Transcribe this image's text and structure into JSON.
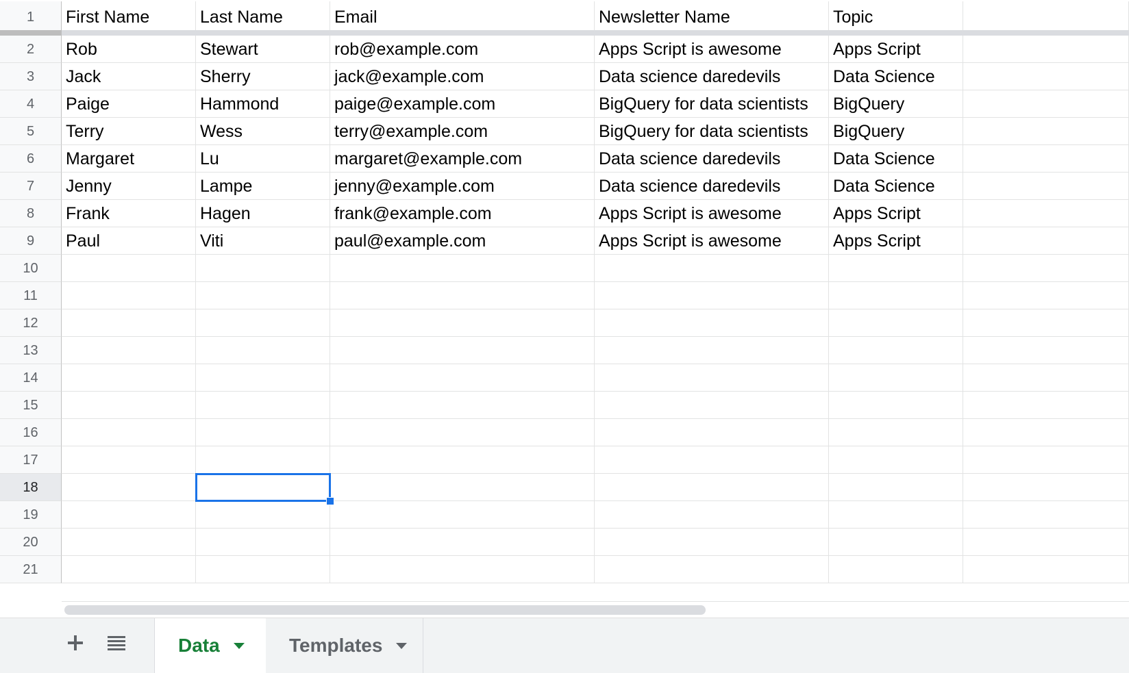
{
  "spreadsheet": {
    "row_numbers": [
      "1",
      "2",
      "3",
      "4",
      "5",
      "6",
      "7",
      "8",
      "9",
      "10",
      "11",
      "12",
      "13",
      "14",
      "15",
      "16",
      "17",
      "18",
      "19",
      "20",
      "21"
    ],
    "rows": [
      [
        "First Name",
        "Last Name",
        "Email",
        "Newsletter Name",
        "Topic",
        ""
      ],
      [
        "Rob",
        "Stewart",
        "rob@example.com",
        "Apps Script is awesome",
        "Apps Script",
        ""
      ],
      [
        "Jack",
        "Sherry",
        "jack@example.com",
        "Data science daredevils",
        "Data Science",
        ""
      ],
      [
        "Paige",
        "Hammond",
        "paige@example.com",
        "BigQuery for data scientists",
        "BigQuery",
        ""
      ],
      [
        "Terry",
        "Wess",
        "terry@example.com",
        "BigQuery for data scientists",
        "BigQuery",
        ""
      ],
      [
        "Margaret",
        "Lu",
        "margaret@example.com",
        "Data science daredevils",
        "Data Science",
        ""
      ],
      [
        "Jenny",
        "Lampe",
        "jenny@example.com",
        "Data science daredevils",
        "Data Science",
        ""
      ],
      [
        "Frank",
        "Hagen",
        "frank@example.com",
        "Apps Script is awesome",
        "Apps Script",
        ""
      ],
      [
        "Paul",
        "Viti",
        "paul@example.com",
        "Apps Script is awesome",
        "Apps Script",
        ""
      ],
      [
        "",
        "",
        "",
        "",
        "",
        ""
      ],
      [
        "",
        "",
        "",
        "",
        "",
        ""
      ],
      [
        "",
        "",
        "",
        "",
        "",
        ""
      ],
      [
        "",
        "",
        "",
        "",
        "",
        ""
      ],
      [
        "",
        "",
        "",
        "",
        "",
        ""
      ],
      [
        "",
        "",
        "",
        "",
        "",
        ""
      ],
      [
        "",
        "",
        "",
        "",
        "",
        ""
      ],
      [
        "",
        "",
        "",
        "",
        "",
        ""
      ],
      [
        "",
        "",
        "",
        "",
        "",
        ""
      ],
      [
        "",
        "",
        "",
        "",
        "",
        ""
      ],
      [
        "",
        "",
        "",
        "",
        "",
        ""
      ],
      [
        "",
        "",
        "",
        "",
        "",
        ""
      ]
    ],
    "selected_cell": {
      "row": 18,
      "col": 2
    }
  },
  "tabbar": {
    "add_sheet_icon": "plus-icon",
    "all_sheets_icon": "list-icon",
    "add_glyph": "+",
    "list_glyph": "≣",
    "tabs": [
      {
        "label": "Data",
        "active": true
      },
      {
        "label": "Templates",
        "active": false
      }
    ]
  },
  "colors": {
    "selection": "#1a73e8",
    "active_tab_text": "#188038"
  }
}
